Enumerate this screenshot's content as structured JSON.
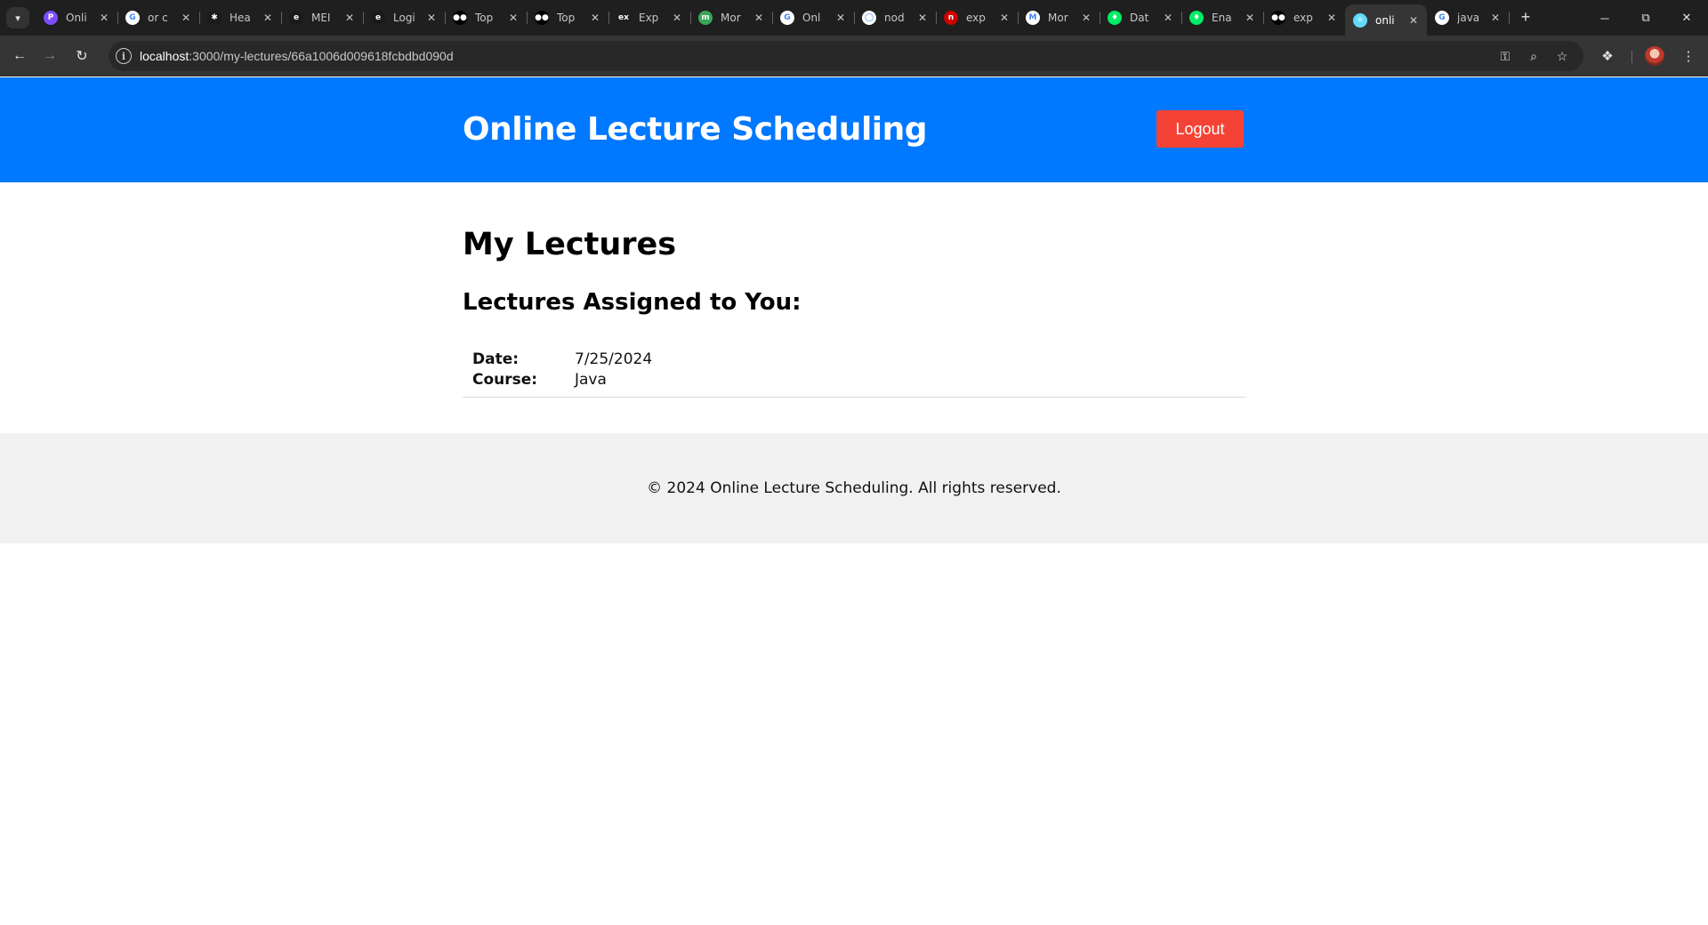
{
  "browser": {
    "tabs": [
      {
        "title": "Onli",
        "favicon_color": "#7b4dff",
        "favicon_glyph": "P"
      },
      {
        "title": "or c",
        "favicon_color": "#ffffff",
        "favicon_glyph": "G"
      },
      {
        "title": "Hea",
        "favicon_color": "#1a1a1a",
        "favicon_glyph": "✱"
      },
      {
        "title": "MEI",
        "favicon_color": "#1a1a1a",
        "favicon_glyph": "e"
      },
      {
        "title": "Logi",
        "favicon_color": "#1a1a1a",
        "favicon_glyph": "e"
      },
      {
        "title": "Top",
        "favicon_color": "#000000",
        "favicon_glyph": "●●"
      },
      {
        "title": "Top",
        "favicon_color": "#000000",
        "favicon_glyph": "●●"
      },
      {
        "title": "Exp",
        "favicon_color": "#1f1f1f",
        "favicon_glyph": "ex"
      },
      {
        "title": "Mor",
        "favicon_color": "#3aa655",
        "favicon_glyph": "m"
      },
      {
        "title": "Onl",
        "favicon_color": "#ffffff",
        "favicon_glyph": "G"
      },
      {
        "title": "nod",
        "favicon_color": "#ffffff",
        "favicon_glyph": "◯"
      },
      {
        "title": "exp",
        "favicon_color": "#cc0000",
        "favicon_glyph": "n"
      },
      {
        "title": "Mor",
        "favicon_color": "#ffffff",
        "favicon_glyph": "M"
      },
      {
        "title": "Dat",
        "favicon_color": "#00ed64",
        "favicon_glyph": "♦"
      },
      {
        "title": "Ena",
        "favicon_color": "#00ed64",
        "favicon_glyph": "♦"
      },
      {
        "title": "exp",
        "favicon_color": "#000000",
        "favicon_glyph": "●●"
      },
      {
        "title": "onli",
        "favicon_color": "#61dafb",
        "favicon_glyph": "⚛",
        "active": true
      },
      {
        "title": "java",
        "favicon_color": "#ffffff",
        "favicon_glyph": "G"
      }
    ],
    "url_host": "localhost",
    "url_path": ":3000/my-lectures/66a1006d009618fcbdbd090d"
  },
  "header": {
    "title": "Online Lecture Scheduling",
    "logout_label": "Logout"
  },
  "main": {
    "heading": "My Lectures",
    "subheading": "Lectures Assigned to You:",
    "lectures": [
      {
        "date_label": "Date:",
        "date": "7/25/2024",
        "course_label": "Course:",
        "course": "Java"
      }
    ]
  },
  "footer": {
    "text": "© 2024 Online Lecture Scheduling. All rights reserved."
  },
  "colors": {
    "header_bg": "#0078ff",
    "logout_bg": "#f44336",
    "footer_bg": "#f1f1f1"
  }
}
